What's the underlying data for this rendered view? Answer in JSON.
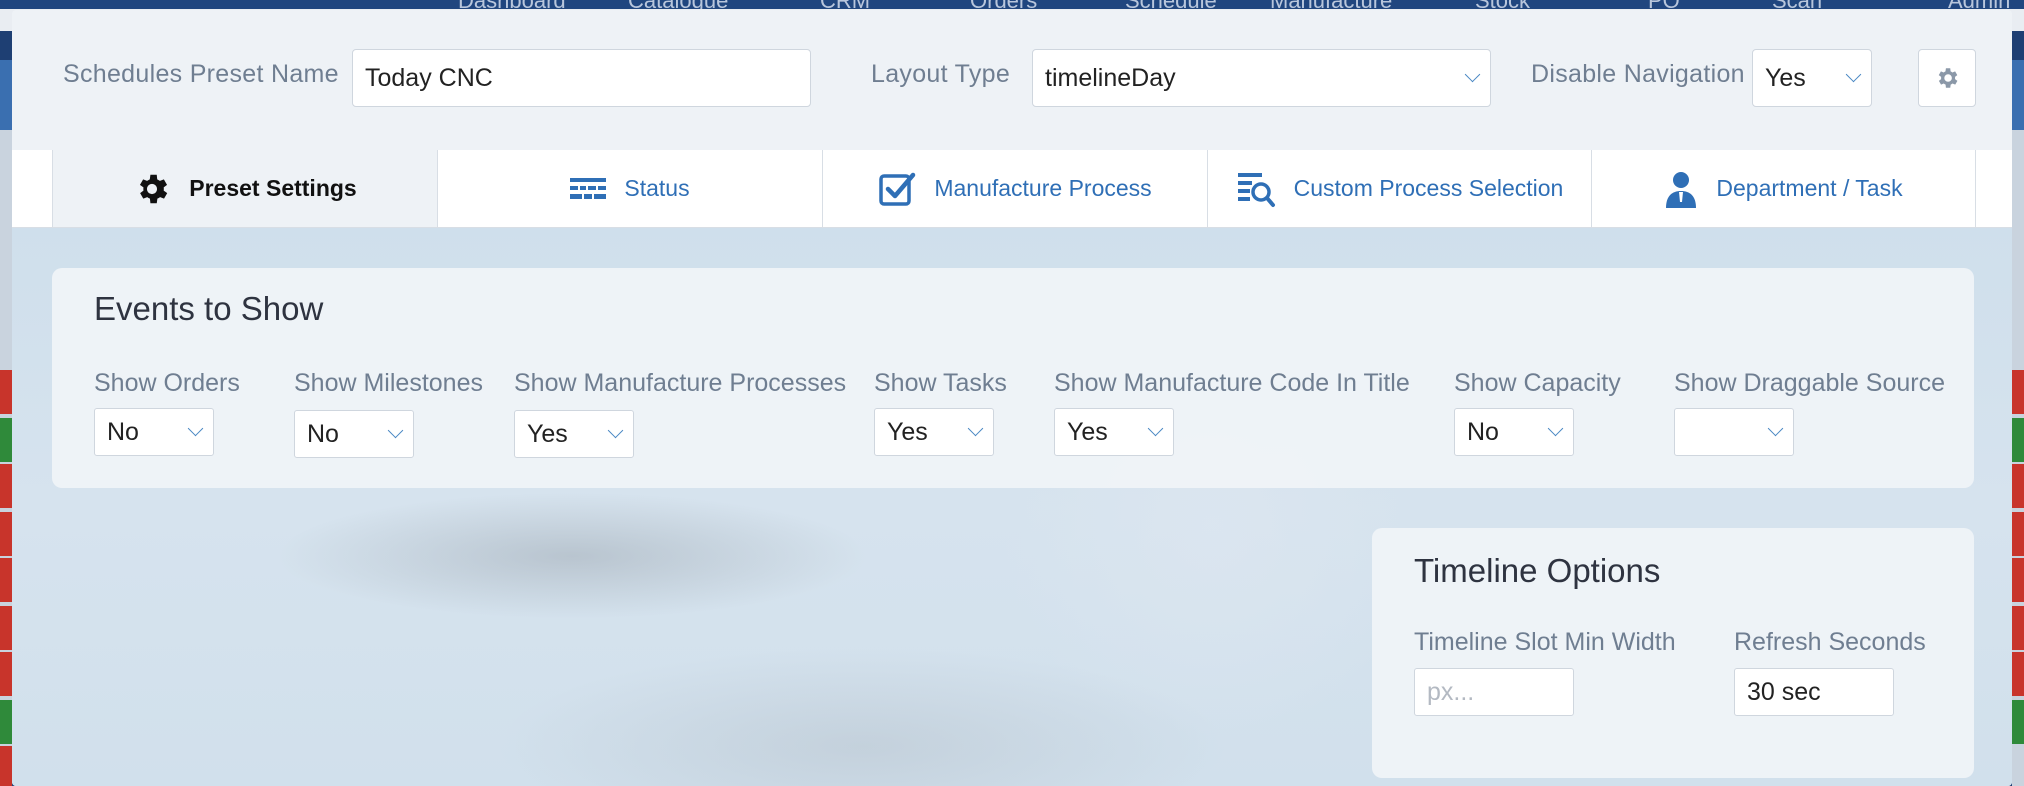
{
  "background_nav": {
    "items": [
      "Dashboard",
      "Catalogue",
      "CRM",
      "Orders",
      "Schedule",
      "Manufacture",
      "Stock",
      "PO",
      "Scan",
      "Admin"
    ]
  },
  "header": {
    "preset_name_label": "Schedules Preset Name",
    "preset_name_value": "Today CNC",
    "layout_type_label": "Layout Type",
    "layout_type_value": "timelineDay",
    "disable_nav_label": "Disable Navigation",
    "disable_nav_value": "Yes"
  },
  "tabs": [
    {
      "label": "Preset Settings",
      "icon": "gear-icon",
      "active": true
    },
    {
      "label": "Status",
      "icon": "status-bars-icon",
      "active": false
    },
    {
      "label": "Manufacture Process",
      "icon": "checkbox-icon",
      "active": false
    },
    {
      "label": "Custom Process Selection",
      "icon": "list-search-icon",
      "active": false
    },
    {
      "label": "Department / Task",
      "icon": "person-icon",
      "active": false
    }
  ],
  "events_panel": {
    "title": "Events to Show",
    "options": [
      {
        "label": "Show Orders",
        "value": "No"
      },
      {
        "label": "Show Milestones",
        "value": "No"
      },
      {
        "label": "Show Manufacture Processes",
        "value": "Yes"
      },
      {
        "label": "Show Tasks",
        "value": "Yes"
      },
      {
        "label": "Show Manufacture Code In Title",
        "value": "Yes"
      },
      {
        "label": "Show Capacity",
        "value": "No"
      },
      {
        "label": "Show Draggable Source",
        "value": ""
      }
    ]
  },
  "timeline_panel": {
    "title": "Timeline Options",
    "slot_min_width_label": "Timeline Slot Min Width",
    "slot_min_width_placeholder": "px...",
    "refresh_label": "Refresh Seconds",
    "refresh_value": "30 sec"
  },
  "colors": {
    "accent": "#2f6fb6",
    "label": "#6f7e91",
    "row_red": "#c8342b",
    "row_green": "#2f8a3a"
  }
}
